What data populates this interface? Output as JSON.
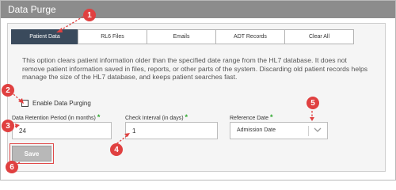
{
  "window": {
    "title": "Data Purge"
  },
  "tabs": [
    {
      "label": "Patient Data",
      "active": true
    },
    {
      "label": "RL6 Files",
      "active": false
    },
    {
      "label": "Emails",
      "active": false
    },
    {
      "label": "ADT Records",
      "active": false
    },
    {
      "label": "Clear All",
      "active": false
    }
  ],
  "description": "This option clears patient information older than the specified date range from the HL7 database. It does not remove patient information saved in files, reports, or other parts of the system. Discarding old patient records helps manage the size of the HL7 database, and keeps patient searches fast.",
  "enable_purging": {
    "label": "Enable Data Purging",
    "checked": false
  },
  "fields": {
    "retention": {
      "label": "Data Retention Period (in months)",
      "required": "*",
      "value": "24"
    },
    "interval": {
      "label": "Check Interval (in days)",
      "required": "*",
      "value": "1"
    },
    "reference": {
      "label": "Reference Date",
      "required": "*",
      "value": "Admission Date",
      "icon": "chevron-down-icon"
    }
  },
  "save_button": {
    "label": "Save"
  },
  "callouts": [
    "1",
    "2",
    "3",
    "4",
    "5",
    "6"
  ],
  "colors": {
    "titlebar": "#8c8c8c",
    "active_tab": "#3a4a5c",
    "required": "#2fa82f",
    "callout": "#e04040"
  }
}
